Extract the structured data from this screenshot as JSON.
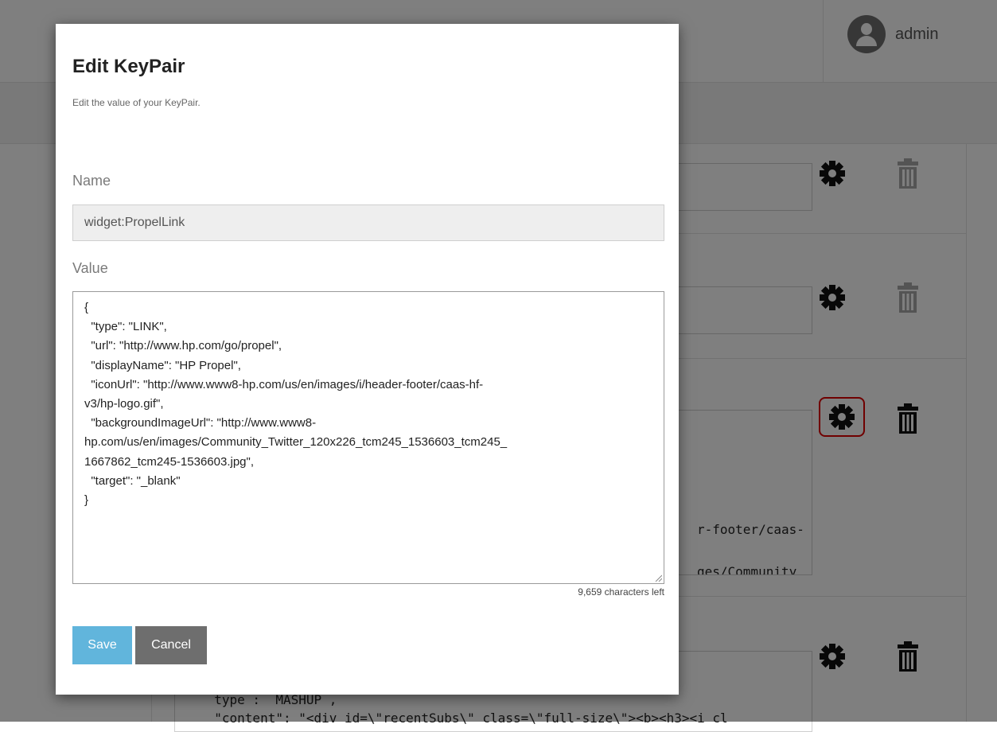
{
  "header": {
    "username": "admin"
  },
  "background_rows": [
    {
      "lines": []
    },
    {
      "lines": []
    },
    {
      "lines": [
        "r-footer/caas-",
        "ges/Community"
      ]
    },
    {
      "lines": [
        "  type :  MASHUP ,",
        "  \"content\": \"<div id=\\\"recentSubs\\\" class=\\\"full-size\\\"><b><h3><i cl"
      ]
    }
  ],
  "modal": {
    "title": "Edit KeyPair",
    "subtitle": "Edit the value of your KeyPair.",
    "name_label": "Name",
    "name_value": "widget:PropelLink",
    "value_label": "Value",
    "value_lines": [
      "{",
      "  \"type\": \"LINK\",",
      "  \"url\": \"http://www.hp.com/go/propel\",",
      "  \"displayName\": \"HP Propel\",",
      "  \"iconUrl\": \"http://www.www8-hp.com/us/en/images/i/header-footer/caas-hf-",
      "v3/hp-logo.gif\",",
      "  \"backgroundImageUrl\": \"http://www.www8-",
      "hp.com/us/en/images/Community_Twitter_120x226_tcm245_1536603_tcm245_",
      "1667862_tcm245-1536603.jpg\",",
      "  \"target\": \"_blank\"",
      "}"
    ],
    "chars_left": "9,659 characters left",
    "save_label": "Save",
    "cancel_label": "Cancel"
  },
  "icons": {
    "settings": "gear-icon",
    "delete": "trash-icon",
    "user": "user-icon"
  }
}
